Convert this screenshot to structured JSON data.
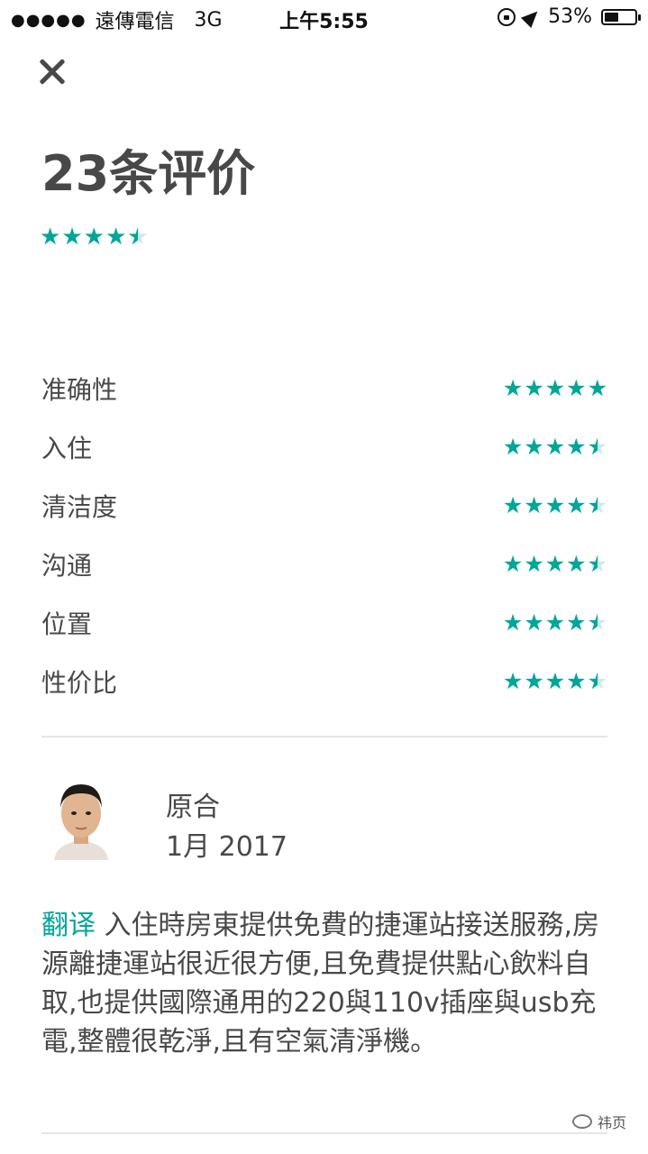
{
  "status_bar": {
    "carrier": "遠傳電信",
    "network": "3G",
    "time": "上午5:55",
    "battery": "53%",
    "battery_level": 0.53
  },
  "header": {
    "close_icon": "close-icon",
    "title": "23条评价"
  },
  "overall_rating": 4.5,
  "categories": [
    {
      "label": "准确性",
      "rating": 5
    },
    {
      "label": "入住",
      "rating": 4.5
    },
    {
      "label": "清洁度",
      "rating": 4.5
    },
    {
      "label": "沟通",
      "rating": 4.5
    },
    {
      "label": "位置",
      "rating": 4.5
    },
    {
      "label": "性价比",
      "rating": 4.5
    }
  ],
  "review": {
    "author": "原合",
    "date": "1月 2017",
    "translate_label": "翻译",
    "text": "入住時房東提供免費的捷運站接送服務,房源離捷運站很近很方便,且免費提供點心飲料自取,也提供國際通用的220與110v插座與usb充電,整體很乾淨,且有空氣清淨機。"
  },
  "watermark": "祎页",
  "colors": {
    "accent": "#00a699",
    "text": "#484848",
    "divider": "#e6e6e6"
  }
}
